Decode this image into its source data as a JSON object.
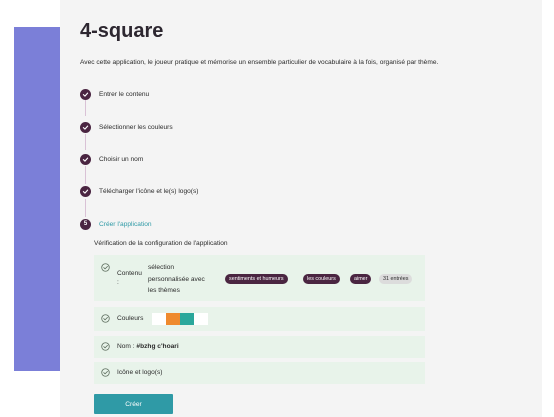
{
  "header": {
    "title": "4-square",
    "description": "Avec cette application, le joueur pratique et mémorise un ensemble particulier de vocabulaire à la fois, organisé par thème."
  },
  "steps": [
    {
      "label": "Entrer le contenu",
      "state": "done"
    },
    {
      "label": "Sélectionner les couleurs",
      "state": "done"
    },
    {
      "label": "Choisir un nom",
      "state": "done"
    },
    {
      "label": "Télécharger l'icône et le(s) logo(s)",
      "state": "done"
    },
    {
      "number": "5",
      "label": "Créer l'application",
      "state": "active"
    }
  ],
  "verification": {
    "title": "Vérification de la configuration de l'application",
    "content": {
      "label_line1": "Contenu",
      "label_line2": ":",
      "selection_line1": "sélection",
      "selection_line2": "personnalisée avec",
      "selection_line3": "les thèmes",
      "tags": [
        "sentiments et humeurs",
        "les couleurs",
        "aimer"
      ],
      "count": "31 entrées"
    },
    "colors": {
      "label": "Couleurs",
      "swatches": [
        "#ffffff",
        "#ef8a2e",
        "#2aa79b",
        "#ffffff"
      ]
    },
    "name": {
      "label": "Nom : ",
      "value": "#bzhg c'hoari"
    },
    "icons": {
      "label": "Icône et logo(s)"
    }
  },
  "actions": {
    "create_label": "Créer"
  },
  "colors": {
    "accent": "#2f9aa6",
    "step_dot": "#4a2541",
    "card_bg": "#e8f3ea",
    "left_band": "#7b7fd8"
  }
}
